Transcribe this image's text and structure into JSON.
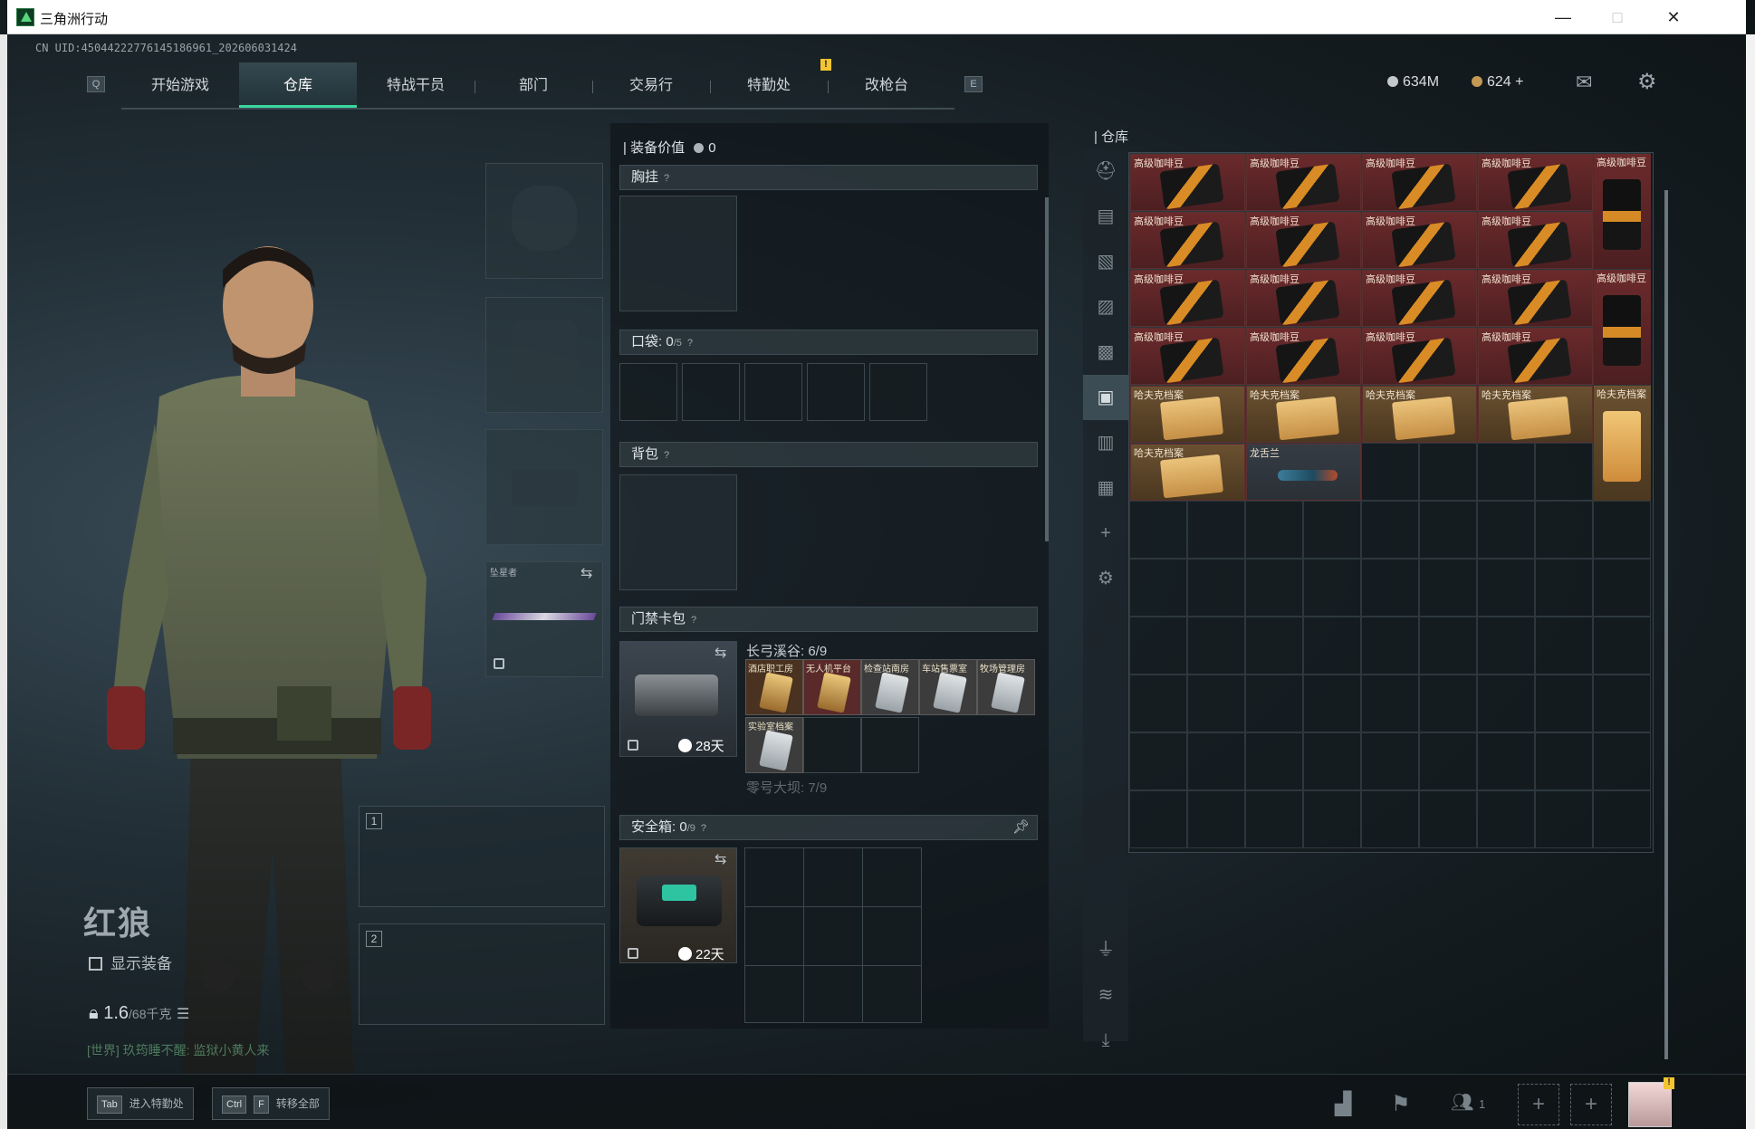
{
  "window": {
    "title": "三角洲行动",
    "minimize": "—",
    "maximize": "□",
    "close": "✕"
  },
  "uid": "CN UID:450442227761451869​61_202606031424",
  "nav": {
    "left_key": "Q",
    "right_key": "E",
    "tabs": [
      "开始游戏",
      "仓库",
      "特战干员",
      "部门",
      "交易行",
      "特勤处",
      "改枪台"
    ],
    "active_tab": "仓库",
    "alert_badge": "!"
  },
  "currency": {
    "coins": "634M",
    "tokens": "624",
    "add": "+"
  },
  "character": {
    "name": "红狼",
    "show_equipment_label": "显示装备",
    "weight": "1.6",
    "weight_max": "/68千克",
    "chat": "[世界] 玖筠睡不醒: 监狱小黄人来"
  },
  "melee_slot": {
    "label": "坠星者"
  },
  "weapon_slots": [
    {
      "num": "1"
    },
    {
      "num": "2"
    }
  ],
  "middle": {
    "equip_value_label": "装备价值",
    "equip_value": "0",
    "chest_rig": "胸挂",
    "pockets_label": "口袋:",
    "pockets_count": "0",
    "pockets_max": "/5",
    "backpack": "背包",
    "keycard_label": "门禁卡包",
    "keycard_timer": "28天",
    "map1_label": "长弓溪谷: 6/9",
    "map2_label": "零号大坝: 7/9",
    "keycards": [
      {
        "name": "酒店职工房",
        "style": "gold"
      },
      {
        "name": "无人机平台",
        "style": "red"
      },
      {
        "name": "检查站南房",
        "style": "grey"
      },
      {
        "name": "车站售票室",
        "style": "grey"
      },
      {
        "name": "牧场管理房",
        "style": "grey"
      },
      {
        "name": "实验室档案",
        "style": "grey"
      }
    ],
    "safe_label": "安全箱:",
    "safe_count": "0",
    "safe_max": "/9",
    "safe_timer": "22天",
    "help": "?"
  },
  "warehouse": {
    "title": "仓库",
    "items": [
      {
        "name": "高级咖啡豆",
        "style": "red"
      },
      {
        "name": "哈夫克档案",
        "style": "gold"
      },
      {
        "name": "龙舌兰",
        "style": "blue"
      }
    ]
  },
  "bottom": {
    "tab_key": "Tab",
    "tab_label": "进入特勤处",
    "ctrl_key": "Ctrl",
    "f_key": "F",
    "ctrl_label": "转移全部",
    "squad_count": "1"
  },
  "colors": {
    "accent": "#3ad6a0",
    "coffee": "#6b2a2c",
    "archive": "#6a5030",
    "warning": "#f3c531"
  }
}
